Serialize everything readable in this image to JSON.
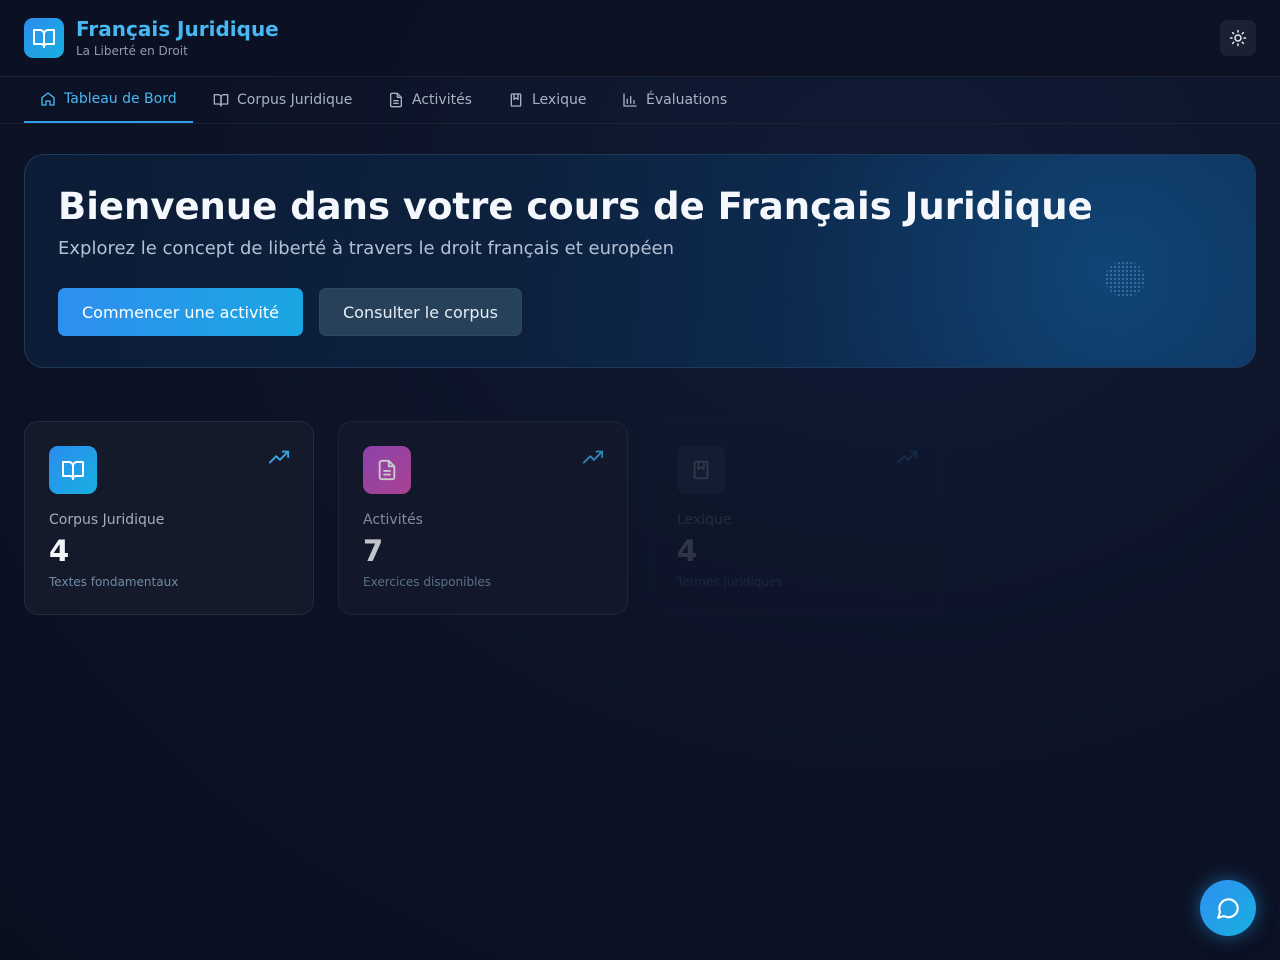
{
  "app": {
    "title": "Français Juridique",
    "subtitle": "La Liberté en Droit",
    "logo_icon": "book-open-icon",
    "accent_color": "#47b8f2"
  },
  "header": {
    "theme_toggle_icon": "sun-icon"
  },
  "nav": {
    "tabs": [
      {
        "label": "Tableau de Bord",
        "icon": "home-icon",
        "active": true
      },
      {
        "label": "Corpus Juridique",
        "icon": "book-open-icon",
        "active": false
      },
      {
        "label": "Activités",
        "icon": "file-text-icon",
        "active": false
      },
      {
        "label": "Lexique",
        "icon": "bookmark-icon",
        "active": false
      },
      {
        "label": "Évaluations",
        "icon": "bar-chart-icon",
        "active": false
      }
    ]
  },
  "hero": {
    "title": "Bienvenue dans votre cours de Français Juridique",
    "subtitle": "Explorez le concept de liberté à travers le droit français et européen",
    "primary_button": "Commencer une activité",
    "secondary_button": "Consulter le corpus"
  },
  "stats": [
    {
      "label": "Corpus Juridique",
      "value": "4",
      "description": "Textes fondamentaux",
      "icon": "book-open-icon",
      "color": "#2b8cf0"
    },
    {
      "label": "Activités",
      "value": "7",
      "description": "Exercices disponibles",
      "icon": "file-text-icon",
      "color": "#b04fcf"
    },
    {
      "label": "Lexique",
      "value": "4",
      "description": "Termes juridiques",
      "icon": "bookmark-icon",
      "color": "#3a4256"
    }
  ],
  "chat": {
    "icon": "message-circle-icon"
  }
}
